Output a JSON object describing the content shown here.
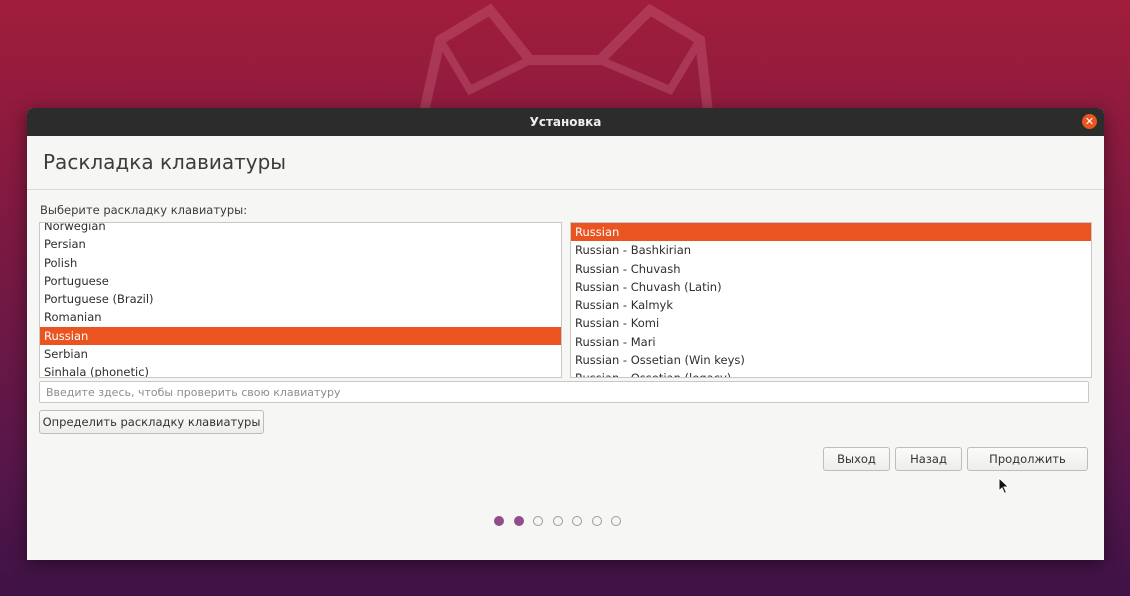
{
  "window": {
    "title": "Установка",
    "close_icon": "close-icon"
  },
  "page": {
    "title": "Раскладка клавиатуры",
    "prompt": "Выберите раскладку клавиатуры:"
  },
  "layouts": {
    "items": [
      "Norwegian",
      "Persian",
      "Polish",
      "Portuguese",
      "Portuguese (Brazil)",
      "Romanian",
      "Russian",
      "Serbian",
      "Sinhala (phonetic)"
    ],
    "selected": "Russian"
  },
  "variants": {
    "items": [
      "Russian",
      "Russian - Bashkirian",
      "Russian - Chuvash",
      "Russian - Chuvash (Latin)",
      "Russian - Kalmyk",
      "Russian - Komi",
      "Russian - Mari",
      "Russian - Ossetian (Win keys)",
      "Russian - Ossetian (legacy)"
    ],
    "selected": "Russian"
  },
  "test_input": {
    "placeholder": "Введите здесь, чтобы проверить свою клавиатуру",
    "value": ""
  },
  "buttons": {
    "detect": "Определить раскладку клавиатуры",
    "quit": "Выход",
    "back": "Назад",
    "continue": "Продолжить"
  },
  "progress": {
    "total_steps": 7,
    "completed_steps": 2
  },
  "colors": {
    "accent": "#e95420",
    "progress_dot": "#924d8b",
    "titlebar": "#2c2c2c"
  }
}
